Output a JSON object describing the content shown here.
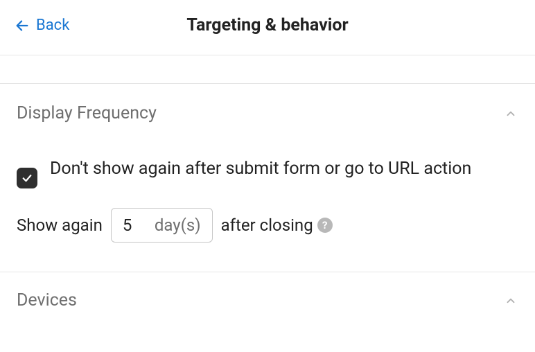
{
  "header": {
    "back_label": "Back",
    "title": "Targeting & behavior"
  },
  "sections": {
    "display_frequency": {
      "title": "Display Frequency",
      "checkbox_label": "Don't show again after submit form or go to URL action",
      "show_again_prefix": "Show again",
      "show_again_value": "5",
      "show_again_unit": "day(s)",
      "show_again_suffix": "after closing",
      "help_symbol": "?"
    },
    "devices": {
      "title": "Devices"
    }
  }
}
